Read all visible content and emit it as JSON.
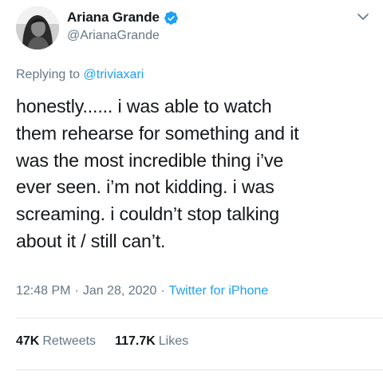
{
  "author": {
    "display_name": "Ariana Grande",
    "handle": "@ArianaGrande",
    "avatar": "profile-photo",
    "verified_icon": "verified-badge-icon"
  },
  "menu_icon": "chevron-down-icon",
  "reply": {
    "prefix": "Replying to ",
    "mention": "@triviaxari"
  },
  "tweet_text": "honestly...... i was able to watch\nthem rehearse for something and it\nwas the most incredible thing i’ve\never seen. i’m not kidding. i was\nscreaming. i couldn’t stop talking\nabout it / still can’t.",
  "meta": {
    "time": "12:48 PM",
    "separator": "·",
    "date": "Jan 28, 2020",
    "source": "Twitter for iPhone"
  },
  "stats": {
    "retweets_count": "47K",
    "retweets_label": "Retweets",
    "likes_count": "117.7K",
    "likes_label": "Likes"
  },
  "colors": {
    "accent": "#1da1f2",
    "text": "#14171a",
    "secondary": "#657786",
    "divider": "#e1e8ed"
  }
}
